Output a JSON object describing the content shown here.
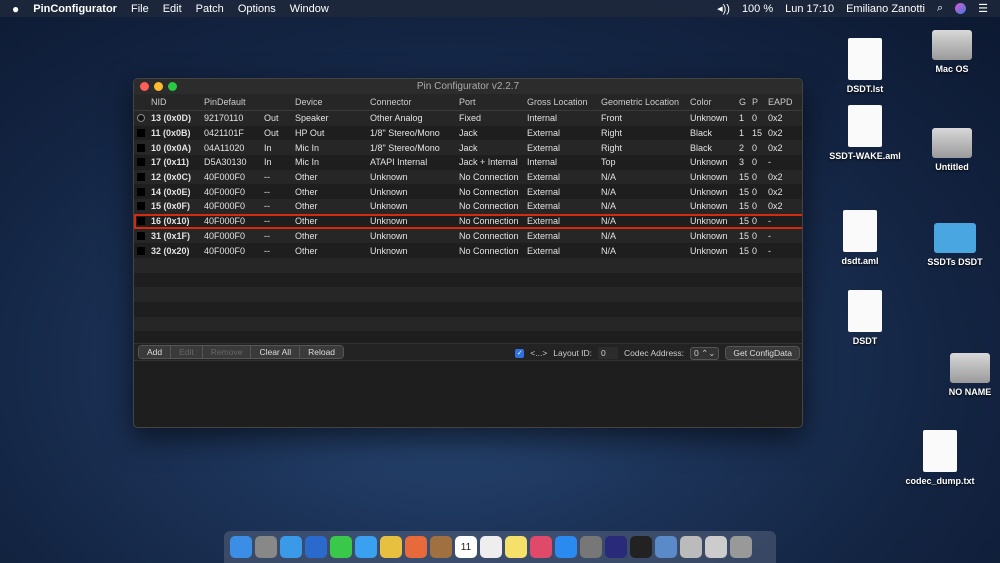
{
  "menubar": {
    "apple": "",
    "app": "PinConfigurator",
    "menus": [
      "File",
      "Edit",
      "Patch",
      "Options",
      "Window"
    ],
    "volume": "◂))",
    "battery": "100 %",
    "clock": "Lun 17:10",
    "user": "Emiliano Zanotti",
    "search": "⌕",
    "list": "☰"
  },
  "window": {
    "title": "Pin Configurator v2.2.7"
  },
  "table": {
    "headers": [
      "NID",
      "PinDefault",
      "",
      "Device",
      "Connector",
      "Port",
      "Gross Location",
      "Geometric Location",
      "Color",
      "G",
      "P",
      "EAPD"
    ],
    "rows": [
      [
        "13 (0x0D)",
        "92170110",
        "Out",
        "Speaker",
        "Other Analog",
        "Fixed",
        "Internal",
        "Front",
        "Unknown",
        "1",
        "0",
        "0x2"
      ],
      [
        "11 (0x0B)",
        "0421101F",
        "Out",
        "HP Out",
        "1/8\" Stereo/Mono",
        "Jack",
        "External",
        "Right",
        "Black",
        "1",
        "15",
        "0x2"
      ],
      [
        "10 (0x0A)",
        "04A11020",
        "In",
        "Mic In",
        "1/8\" Stereo/Mono",
        "Jack",
        "External",
        "Right",
        "Black",
        "2",
        "0",
        "0x2"
      ],
      [
        "17 (0x11)",
        "D5A30130",
        "In",
        "Mic In",
        "ATAPI Internal",
        "Jack + Internal",
        "Internal",
        "Top",
        "Unknown",
        "3",
        "0",
        "-"
      ],
      [
        "12 (0x0C)",
        "40F000F0",
        "--",
        "Other",
        "Unknown",
        "No Connection",
        "External",
        "N/A",
        "Unknown",
        "15",
        "0",
        "0x2"
      ],
      [
        "14 (0x0E)",
        "40F000F0",
        "--",
        "Other",
        "Unknown",
        "No Connection",
        "External",
        "N/A",
        "Unknown",
        "15",
        "0",
        "0x2"
      ],
      [
        "15 (0x0F)",
        "40F000F0",
        "--",
        "Other",
        "Unknown",
        "No Connection",
        "External",
        "N/A",
        "Unknown",
        "15",
        "0",
        "0x2"
      ],
      [
        "16 (0x10)",
        "40F000F0",
        "--",
        "Other",
        "Unknown",
        "No Connection",
        "External",
        "N/A",
        "Unknown",
        "15",
        "0",
        "-"
      ],
      [
        "31 (0x1F)",
        "40F000F0",
        "--",
        "Other",
        "Unknown",
        "No Connection",
        "External",
        "N/A",
        "Unknown",
        "15",
        "0",
        "-"
      ],
      [
        "32 (0x20)",
        "40F000F0",
        "--",
        "Other",
        "Unknown",
        "No Connection",
        "External",
        "N/A",
        "Unknown",
        "15",
        "0",
        "-"
      ]
    ],
    "highlighted_row": "16 (0x10)",
    "highlight_color": "#d42a10"
  },
  "toolbar": {
    "add": "Add",
    "edit": "Edit",
    "remove": "Remove",
    "clear_all": "Clear All",
    "reload": "Reload",
    "toggle_label": "<...>",
    "toggle_checked": true,
    "layout_id_label": "Layout ID:",
    "layout_id": "0",
    "codec_address_label": "Codec Address:",
    "codec_address": "0",
    "stepper": "⌃⌄",
    "get_config": "Get ConfigData"
  },
  "desktop": [
    "DSDT.lst",
    "Mac OS",
    "SSDT-WAKE.aml",
    "Untitled",
    "dsdt.aml",
    "SSDTs DSDT",
    "DSDT",
    "NO NAME",
    "codec_dump.txt"
  ],
  "dock_calendar_day": "11"
}
